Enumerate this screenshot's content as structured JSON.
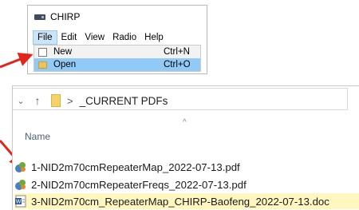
{
  "chirp": {
    "app_icon": "radio-app-icon",
    "title": "CHIRP",
    "menu": [
      "File",
      "Edit",
      "View",
      "Radio",
      "Help"
    ],
    "dropdown": [
      {
        "label": "New",
        "shortcut": "Ctrl+N",
        "icon": "document-icon"
      },
      {
        "label": "Open",
        "shortcut": "Ctrl+O",
        "icon": "folder-icon",
        "highlighted": true
      }
    ]
  },
  "explorer": {
    "breadcrumb": "_CURRENT PDFs",
    "breadcrumb_sep": ">",
    "column_header": "Name",
    "files": [
      {
        "name": "1-NID2m70cmRepeaterMap_2022-07-13.pdf",
        "icon": "pdf-file-icon"
      },
      {
        "name": "2-NID2m70cmRepeaterFreqs_2022-07-13.pdf",
        "icon": "pdf-file-icon"
      },
      {
        "name": "3-NID2m70cm_RepeaterMap_CHIRP-Baofeng_2022-07-13.doc",
        "icon": "word-document-icon",
        "highlighted": true
      }
    ]
  },
  "colors": {
    "arrow": "#e0251b",
    "menu_highlight": "#91c9f7",
    "file_highlight": "#fff7bf",
    "column_header": "#4c607a"
  }
}
